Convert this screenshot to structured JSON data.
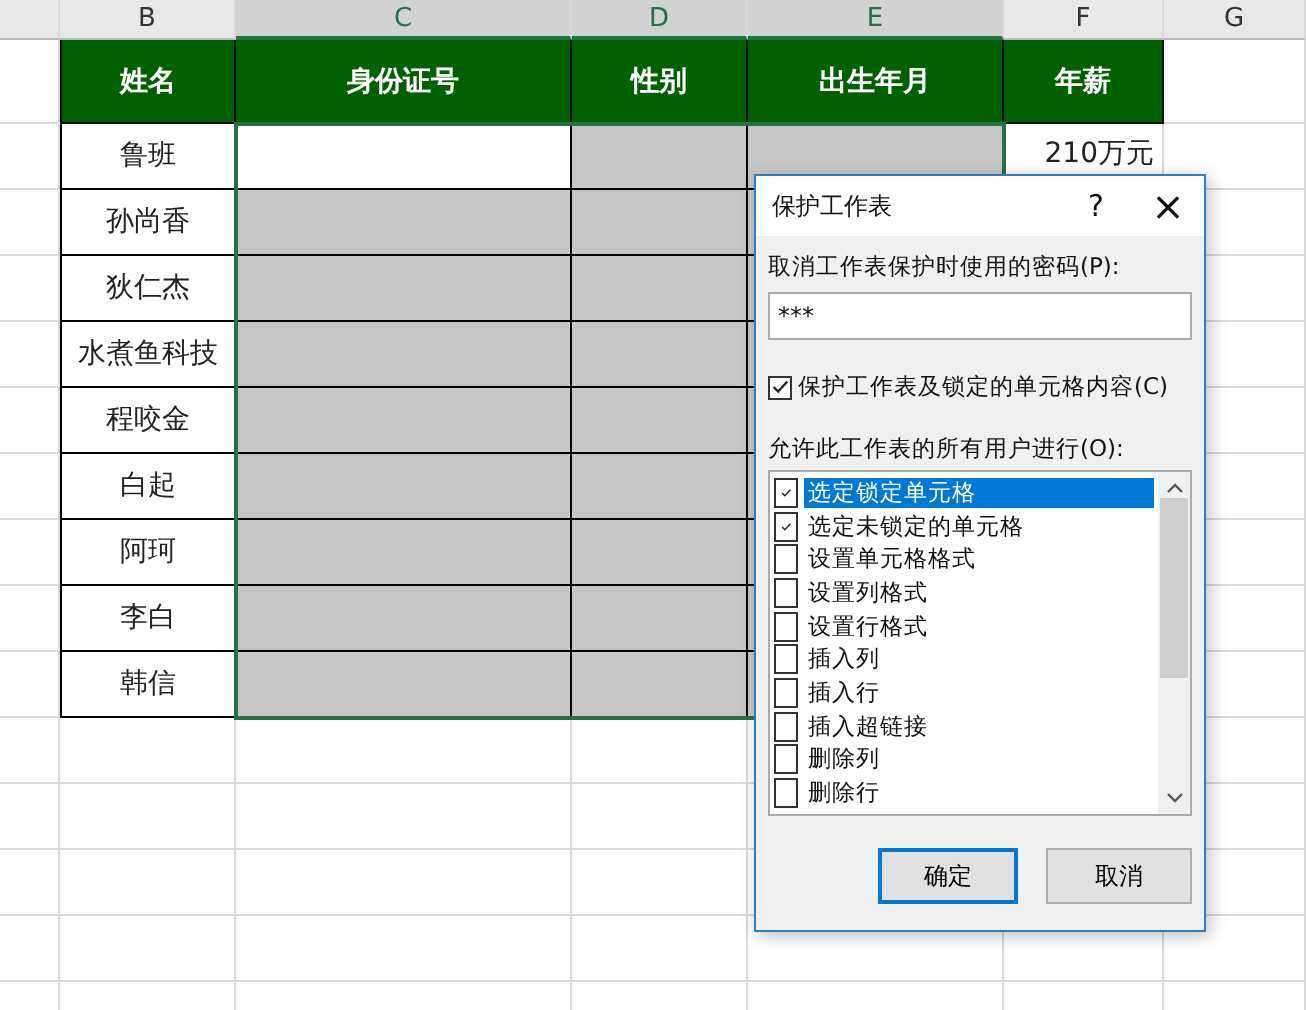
{
  "sheet": {
    "columns": [
      {
        "letter": "B",
        "selected": false
      },
      {
        "letter": "C",
        "selected": true
      },
      {
        "letter": "D",
        "selected": true
      },
      {
        "letter": "E",
        "selected": true
      },
      {
        "letter": "F",
        "selected": false
      },
      {
        "letter": "G",
        "selected": false
      }
    ],
    "headers": [
      "姓名",
      "身份证号",
      "性别",
      "出生年月",
      "年薪"
    ],
    "rows": [
      {
        "name": "鲁班",
        "active": true,
        "salary": "210万元"
      },
      {
        "name": "孙尚香",
        "active": false
      },
      {
        "name": "狄仁杰",
        "active": false
      },
      {
        "name": "水煮鱼科技",
        "active": false
      },
      {
        "name": "程咬金",
        "active": false
      },
      {
        "name": "白起",
        "active": false
      },
      {
        "name": "阿珂",
        "active": false
      },
      {
        "name": "李白",
        "active": false
      },
      {
        "name": "韩信",
        "active": false
      }
    ]
  },
  "dialog": {
    "title": "保护工作表",
    "help": "?",
    "close": "×",
    "password_label": "取消工作表保护时使用的密码(P):",
    "password": "***",
    "protect": {
      "label": "保护工作表及锁定的单元格内容(C)",
      "checked": true
    },
    "allow_label": "允许此工作表的所有用户进行(O):",
    "permissions": [
      {
        "label": "选定锁定单元格",
        "checked": true,
        "selected": true
      },
      {
        "label": "选定未锁定的单元格",
        "checked": true,
        "selected": false
      },
      {
        "label": "设置单元格格式",
        "checked": false,
        "selected": false
      },
      {
        "label": "设置列格式",
        "checked": false,
        "selected": false
      },
      {
        "label": "设置行格式",
        "checked": false,
        "selected": false
      },
      {
        "label": "插入列",
        "checked": false,
        "selected": false
      },
      {
        "label": "插入行",
        "checked": false,
        "selected": false
      },
      {
        "label": "插入超链接",
        "checked": false,
        "selected": false
      },
      {
        "label": "删除列",
        "checked": false,
        "selected": false
      },
      {
        "label": "删除行",
        "checked": false,
        "selected": false
      }
    ],
    "buttons": [
      {
        "label": "确定",
        "default": true
      },
      {
        "label": "取消",
        "default": false
      }
    ]
  }
}
